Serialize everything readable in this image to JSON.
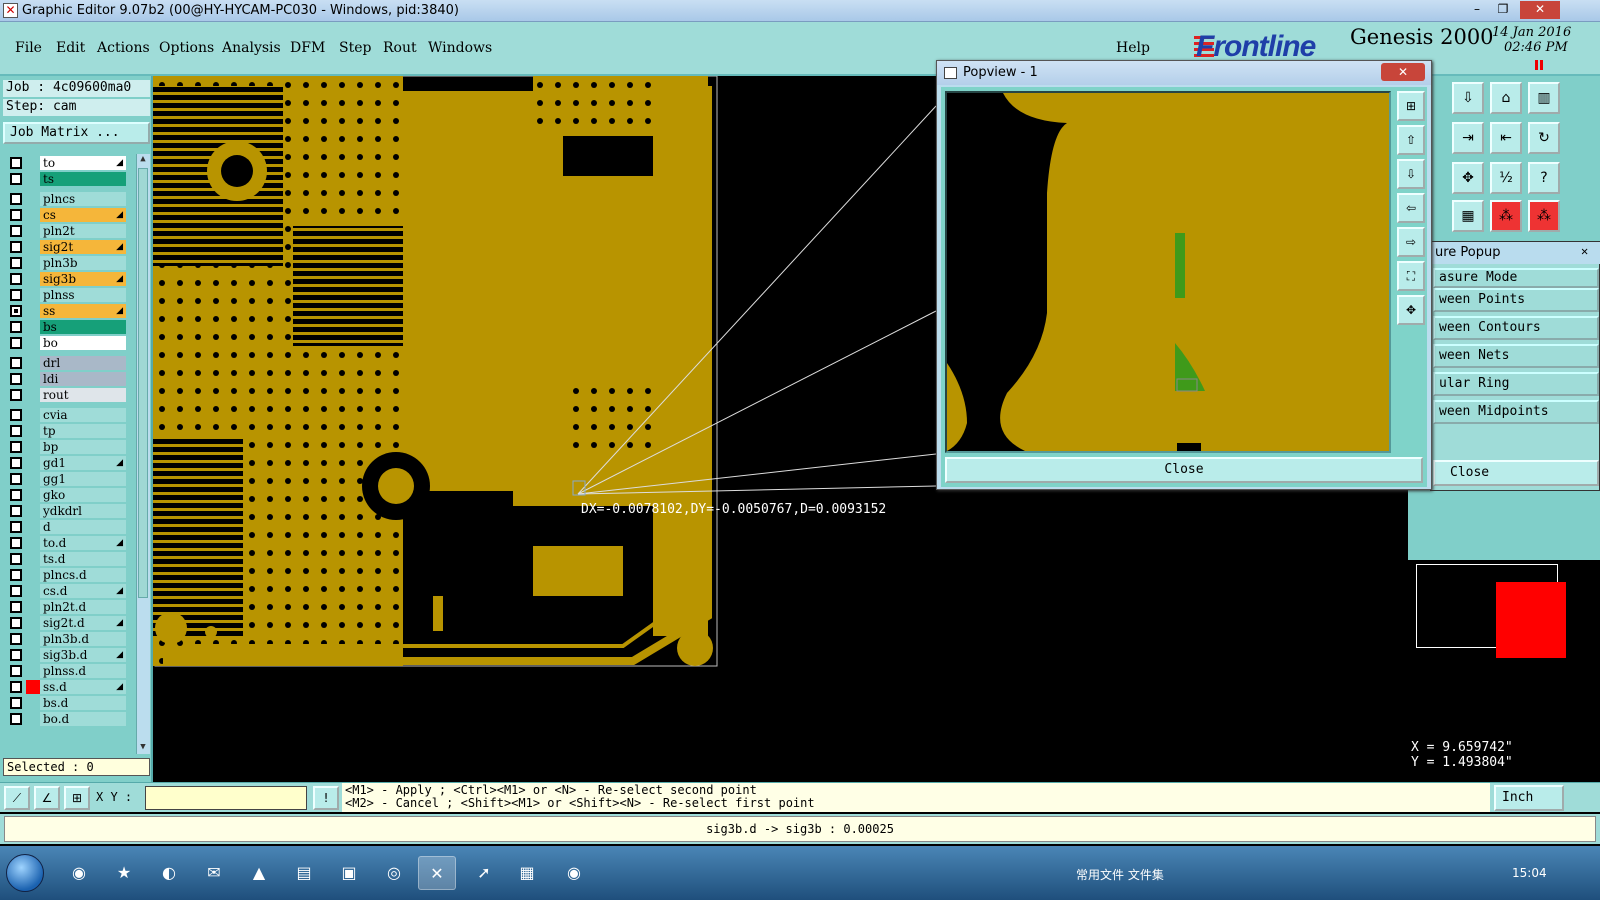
{
  "window": {
    "title": "Graphic Editor 9.07b2 (00@HY-HYCAM-PC030 - Windows, pid:3840)",
    "minimize": "–",
    "restore": "❐",
    "close": "✕"
  },
  "menu": [
    {
      "label": "File"
    },
    {
      "label": "Edit"
    },
    {
      "label": "Actions"
    },
    {
      "label": "Options"
    },
    {
      "label": "Analysis"
    },
    {
      "label": "DFM"
    },
    {
      "label": "Step"
    },
    {
      "label": "Rout"
    },
    {
      "label": "Windows"
    },
    {
      "label": "Help"
    }
  ],
  "brand": {
    "logo": "Frontline",
    "product": "Genesis 2000",
    "date": "14 Jan 2016",
    "time": "02:46 PM"
  },
  "job": {
    "job_line": "Job : 4c09600ma0",
    "step_line": "Step: cam",
    "matrix_button": "Job Matrix ..."
  },
  "layers": [
    {
      "name": "to",
      "color": "#ffffff",
      "arrow": true
    },
    {
      "name": "ts",
      "color": "#16a079"
    },
    {
      "name": "plncs",
      "color": "#9fdcd8"
    },
    {
      "name": "cs",
      "color": "#f5b63a",
      "arrow": true
    },
    {
      "name": "pln2t",
      "color": "#9fdcd8"
    },
    {
      "name": "sig2t",
      "color": "#f5b63a",
      "arrow": true
    },
    {
      "name": "pln3b",
      "color": "#9fdcd8"
    },
    {
      "name": "sig3b",
      "color": "#f5b63a",
      "arrow": true
    },
    {
      "name": "plnss",
      "color": "#9fdcd8"
    },
    {
      "name": "ss",
      "color": "#f5b63a",
      "arrow": true,
      "active": true
    },
    {
      "name": "bs",
      "color": "#16a079"
    },
    {
      "name": "bo",
      "color": "#ffffff"
    },
    {
      "name": "drl",
      "color": "#a9b8c8"
    },
    {
      "name": "ldi",
      "color": "#a9b8c8"
    },
    {
      "name": "rout",
      "color": "#dfe5ea"
    },
    {
      "name": "cvia",
      "color": "#9fdcd8"
    },
    {
      "name": "tp",
      "color": "#9fdcd8"
    },
    {
      "name": "bp",
      "color": "#9fdcd8"
    },
    {
      "name": "gd1",
      "color": "#9fdcd8",
      "arrow": true
    },
    {
      "name": "gg1",
      "color": "#9fdcd8"
    },
    {
      "name": "gko",
      "color": "#9fdcd8"
    },
    {
      "name": "ydkdrl",
      "color": "#9fdcd8"
    },
    {
      "name": "d",
      "color": "#9fdcd8"
    },
    {
      "name": "to.d",
      "color": "#9fdcd8",
      "arrow": true
    },
    {
      "name": "ts.d",
      "color": "#9fdcd8"
    },
    {
      "name": "plncs.d",
      "color": "#9fdcd8"
    },
    {
      "name": "cs.d",
      "color": "#9fdcd8",
      "arrow": true
    },
    {
      "name": "pln2t.d",
      "color": "#9fdcd8"
    },
    {
      "name": "sig2t.d",
      "color": "#9fdcd8",
      "arrow": true
    },
    {
      "name": "pln3b.d",
      "color": "#9fdcd8"
    },
    {
      "name": "sig3b.d",
      "color": "#9fdcd8",
      "arrow": true
    },
    {
      "name": "plnss.d",
      "color": "#9fdcd8"
    },
    {
      "name": "ss.d",
      "color": "#9fdcd8",
      "arrow": true,
      "swatch": "#ff0000"
    },
    {
      "name": "bs.d",
      "color": "#9fdcd8"
    },
    {
      "name": "bo.d",
      "color": "#9fdcd8"
    }
  ],
  "selected_label": "Selected : 0",
  "measurement_readout": "DX=-0.0078102,DY=-0.0050767,D=0.0093152",
  "popview": {
    "title": "Popview - 1",
    "close_label": "Close"
  },
  "measure_popup": {
    "title": "ure Popup",
    "options": [
      {
        "label": "asure Mode"
      },
      {
        "label": "ween Points"
      },
      {
        "label": "ween Contours"
      },
      {
        "label": "ween Nets"
      },
      {
        "label": "ular Ring"
      },
      {
        "label": "ween Midpoints"
      }
    ],
    "close_label": "Close"
  },
  "cursor": {
    "x_line": "X = 9.659742\"",
    "y_line": "Y = 1.493804\""
  },
  "command": {
    "xy_label": "X Y :",
    "xy_value": "",
    "hint_line1": "<M1> - Apply  ; <Ctrl><M1> or <N> - Re-select second point",
    "hint_line2": "<M2> - Cancel ; <Shift><M1> or <Shift><N> - Re-select first point",
    "units": "Inch"
  },
  "status_message": "sig3b.d -> sig3b : 0.00025",
  "taskbar": {
    "tray_text": "常用文件   文件集",
    "clock": "15:04"
  },
  "colors": {
    "copper": "#b89400",
    "panel": "#9fdcd8",
    "accent": "#1f3fa8"
  }
}
